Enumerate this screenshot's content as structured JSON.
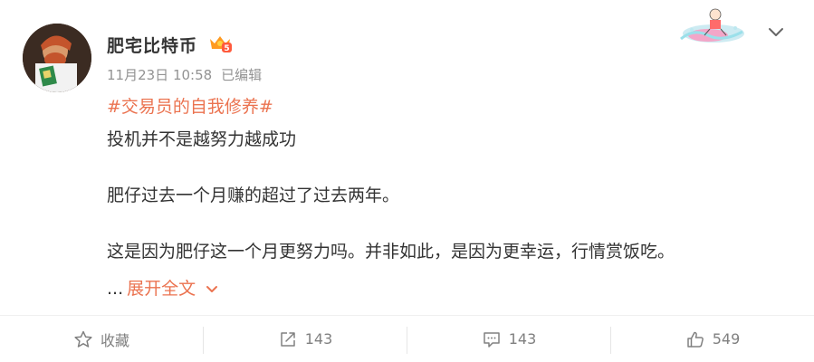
{
  "post": {
    "author": "肥宅比特币",
    "time": "11月23日 10:58",
    "edited": "已编辑",
    "hashtag": "#交易员的自我修养#",
    "lines": [
      "投机并不是越努力越成功",
      "肥仔过去一个月赚的超过了过去两年。",
      "这是因为肥仔这一个月更努力吗。并非如此，是因为更幸运，行情赏饭吃。"
    ],
    "ellipsis": "...",
    "expand_label": "展开全文"
  },
  "actions": {
    "favorite_label": "收藏",
    "repost_count": "143",
    "comment_count": "143",
    "like_count": "549"
  },
  "icons": {
    "more": "chevron-down-icon",
    "favorite": "star-icon",
    "repost": "repost-icon",
    "comment": "comment-icon",
    "like": "thumbs-up-icon"
  },
  "colors": {
    "accent": "#eb7350",
    "text": "#333333",
    "muted": "#939393",
    "action_text": "#808080"
  }
}
